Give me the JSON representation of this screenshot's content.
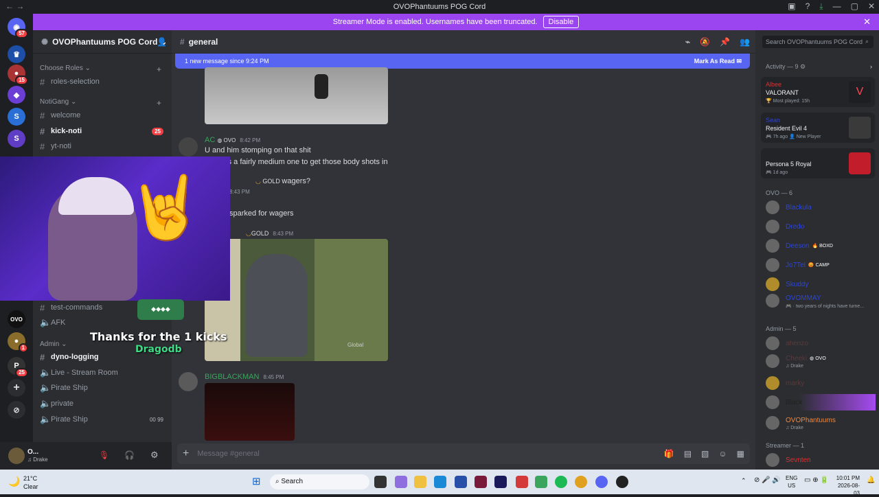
{
  "window": {
    "title": "OVOPhantuums POG Cord"
  },
  "banner": {
    "text": "Streamer Mode is enabled. Usernames have been truncated.",
    "button": "Disable"
  },
  "guilds": {
    "badges": [
      "57",
      "15",
      "1",
      "25"
    ]
  },
  "server": {
    "name": "OVOPhantuums POG Cord"
  },
  "sidebar": {
    "categories": [
      "Choose Roles",
      "NotiGang",
      "Admin"
    ],
    "channels": [
      {
        "name": "roles-selection"
      },
      {
        "name": "welcome"
      },
      {
        "name": "kick-noti",
        "badge": "25"
      },
      {
        "name": "yt-noti"
      },
      {
        "name": "test-commands"
      },
      {
        "name": "AFK"
      },
      {
        "name": "dyno-logging"
      },
      {
        "name": "Live - Stream Room"
      },
      {
        "name": "Pirate Ship"
      },
      {
        "name": "private"
      },
      {
        "name": "Pirate Ship",
        "counts": [
          "00",
          "99"
        ]
      }
    ]
  },
  "user": {
    "name": "O...",
    "status": "Drake"
  },
  "channel": {
    "name": "general"
  },
  "new_messages": {
    "text": "1 new message since 9:24 PM",
    "action": "Mark As Read"
  },
  "messages": [
    {
      "author": "AC",
      "tag": "OVO",
      "time": "8:42 PM",
      "lines": [
        "U and him stomping on that shit",
        "ly it was a fairly medium one to get those body shots in"
      ]
    },
    {
      "tag": "GOLD",
      "text": "wagers?",
      "time": "8:43 PM"
    },
    {
      "text": "sparked for wagers"
    },
    {
      "tag": "GOLD",
      "time": "8:43 PM",
      "watermark": "Global"
    },
    {
      "author": "BIGBLACKMAN",
      "time": "8:45 PM"
    }
  ],
  "composer": {
    "placeholder": "Message #general"
  },
  "right": {
    "search": "Search OVOPhantuums POG Cord",
    "activity_header": "Activity — 9",
    "activities": [
      {
        "user": "Albee",
        "game": "VALORANT",
        "sub": "Most played: 15h"
      },
      {
        "user": "Sean",
        "game": "Resident Evil 4",
        "sub": "7h ago",
        "sub2": "New Player"
      },
      {
        "user": "",
        "game": "Persona 5 Royal",
        "sub": "1d ago"
      }
    ],
    "sections": [
      "OVO — 6",
      "Admin — 5",
      "Streamer — 1"
    ],
    "members_ovo": [
      {
        "name": "Blackula"
      },
      {
        "name": "Dredo"
      },
      {
        "name": "Deeson",
        "tag": "BOXD"
      },
      {
        "name": "Jo7Tel",
        "tag": "CAMP"
      },
      {
        "name": "Skuddy"
      },
      {
        "name": "OVOMMAY",
        "sub": "two years of nights have turne..."
      }
    ],
    "members_admin": [
      {
        "name": "ahenzo"
      },
      {
        "name": "Cheeki",
        "tag": "OVO",
        "sub": "Drake"
      },
      {
        "name": "marky"
      },
      {
        "name": "Black"
      },
      {
        "name": "OVOPhantuums",
        "sub": "Drake"
      }
    ],
    "members_streamer": [
      {
        "name": "Sevnten"
      }
    ]
  },
  "overlay": {
    "line1": "Thanks for the 1 kicks",
    "line2": "Dragodb"
  },
  "taskbar": {
    "weather_temp": "21°C",
    "weather_desc": "Clear",
    "search": "Search",
    "lang": "ENG",
    "region": "US",
    "time": "10:01 PM",
    "date": "2026-08-03"
  }
}
